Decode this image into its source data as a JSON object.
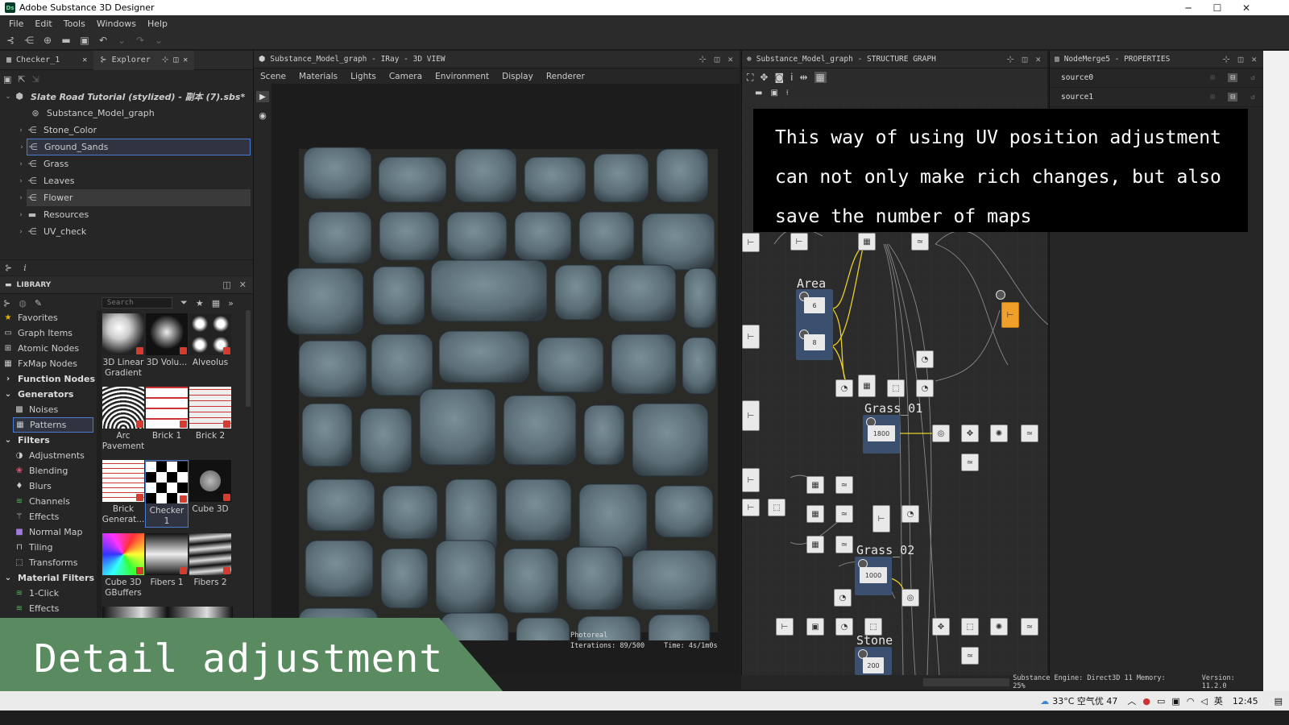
{
  "app": {
    "title": "Adobe Substance 3D Designer",
    "logo": "Ds"
  },
  "menu": [
    "File",
    "Edit",
    "Tools",
    "Windows",
    "Help"
  ],
  "left_tabs": [
    {
      "label": "Checker_1"
    },
    {
      "label": "Explorer"
    }
  ],
  "explorer": {
    "root": "Slate Road Tutorial (stylized) - 副本 (7).sbs*",
    "items": [
      {
        "label": "Substance_Model_graph"
      },
      {
        "label": "Stone_Color"
      },
      {
        "label": "Ground_Sands"
      },
      {
        "label": "Grass"
      },
      {
        "label": "Leaves"
      },
      {
        "label": "Flower"
      },
      {
        "label": "Resources"
      },
      {
        "label": "UV_check"
      }
    ]
  },
  "library": {
    "title": "LIBRARY",
    "search_placeholder": "Search",
    "categories": [
      {
        "label": "Favorites"
      },
      {
        "label": "Graph Items"
      },
      {
        "label": "Atomic Nodes"
      },
      {
        "label": "FxMap Nodes"
      },
      {
        "label": "Function Nodes"
      },
      {
        "label": "Generators"
      },
      {
        "label": "Noises"
      },
      {
        "label": "Patterns"
      },
      {
        "label": "Filters"
      },
      {
        "label": "Adjustments"
      },
      {
        "label": "Blending"
      },
      {
        "label": "Blurs"
      },
      {
        "label": "Channels"
      },
      {
        "label": "Effects"
      },
      {
        "label": "Normal Map"
      },
      {
        "label": "Tiling"
      },
      {
        "label": "Transforms"
      },
      {
        "label": "Material Filters"
      },
      {
        "label": "1-Click"
      },
      {
        "label": "Effects"
      }
    ],
    "thumbs": [
      {
        "label": "3D Linear Gradient"
      },
      {
        "label": "3D Volu..."
      },
      {
        "label": "Alveolus"
      },
      {
        "label": "Arc Pavement"
      },
      {
        "label": "Brick 1"
      },
      {
        "label": "Brick 2"
      },
      {
        "label": "Brick Generat..."
      },
      {
        "label": "Checker 1"
      },
      {
        "label": "Cube 3D"
      },
      {
        "label": "Cube 3D GBuffers"
      },
      {
        "label": "Fibers 1"
      },
      {
        "label": "Fibers 2"
      }
    ]
  },
  "viewport": {
    "title": "Substance_Model_graph - IRay - 3D VIEW",
    "menus": [
      "Scene",
      "Materials",
      "Lights",
      "Camera",
      "Environment",
      "Display",
      "Renderer"
    ],
    "render_mode": "Photoreal",
    "iterations": "Iterations: 89/500",
    "time": "Time: 4s/1m0s"
  },
  "graph": {
    "title": "Substance_Model_graph - STRUCTURE GRAPH",
    "frames": [
      {
        "label": "Area"
      },
      {
        "label": "Grass_01"
      },
      {
        "label": "Grass_02"
      },
      {
        "label": "Stone"
      }
    ],
    "values": [
      "6",
      "8",
      "1800",
      "1000",
      "200"
    ]
  },
  "properties": {
    "title": "NodeMerge5 - PROPERTIES",
    "rows": [
      {
        "label": "source0"
      },
      {
        "label": "source1"
      }
    ]
  },
  "caption": {
    "lines": [
      "This way of using UV position adjustment",
      "can not only make rich changes, but also",
      "save the number of maps"
    ]
  },
  "banner": {
    "text": "Detail adjustment"
  },
  "status": {
    "engine": "Substance Engine: Direct3D 11 Memory: 25%",
    "version": "Version: 11.2.0"
  },
  "taskbar": {
    "weather": "33°C 空气优 47",
    "ime": "英",
    "clock": "12:45"
  },
  "colors": {
    "accent": "#4a7bd0",
    "banner": "#5a8a5f",
    "output_node": "#f0a02a",
    "frame": "#3b4f6e"
  }
}
